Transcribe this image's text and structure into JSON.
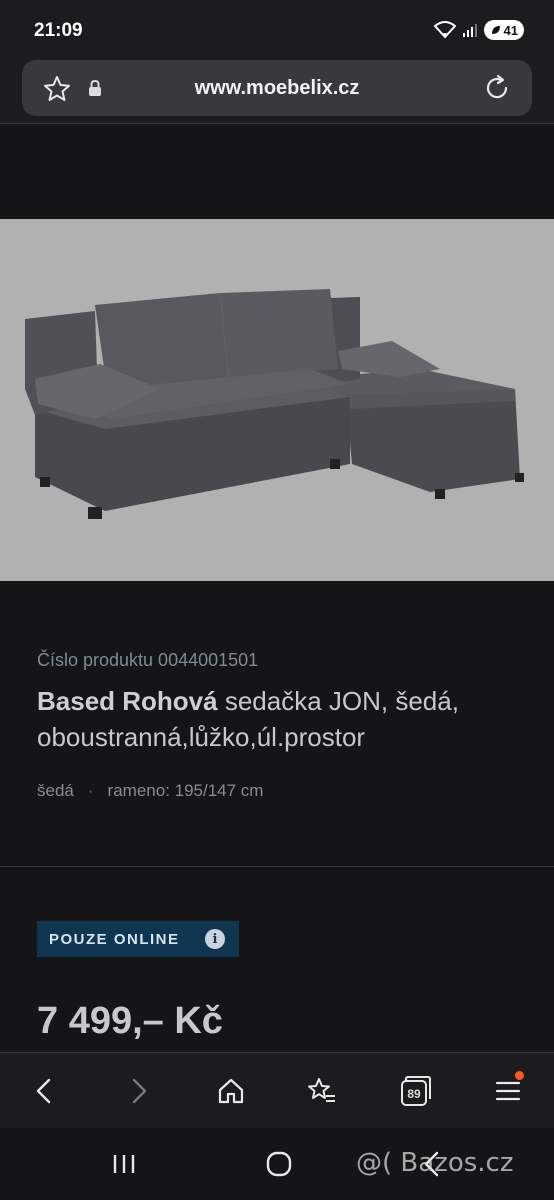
{
  "status": {
    "time": "21:09",
    "battery": "41"
  },
  "browser": {
    "url": "www.moebelix.cz",
    "tabs_count": "89"
  },
  "product": {
    "number_label": "Číslo produktu 0044001501",
    "title_bold": "Based Rohová",
    "title_rest": " sedačka JON, šedá, oboustranná,lůžko,úl.prostor",
    "color": "šedá",
    "dimensions": "rameno: 195/147 cm",
    "badge": "POUZE ONLINE",
    "price": "7 499,– Kč"
  },
  "icons": {
    "favorite": "star-icon",
    "secure": "lock-icon",
    "reload": "reload-icon",
    "back": "chevron-left-icon",
    "forward": "chevron-right-icon",
    "home": "home-icon",
    "bookmarks": "star-list-icon",
    "tabs": "tabs-icon",
    "menu": "hamburger-icon",
    "info": "info-icon"
  },
  "colors": {
    "badge_bg": "#0f3650",
    "notification": "#ff5a1f",
    "page_bg": "#151518"
  },
  "watermark": "@( Bazos.cz"
}
